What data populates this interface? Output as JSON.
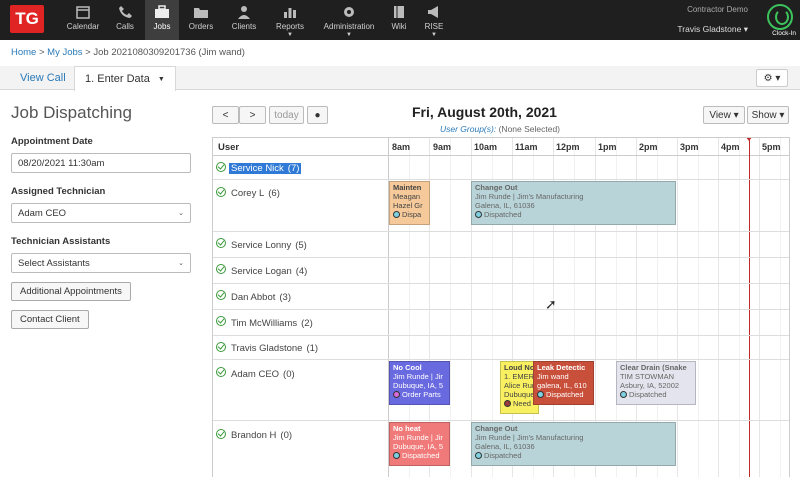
{
  "brand": {
    "logo": "TG",
    "accent": "#e02424"
  },
  "nav": {
    "items": [
      {
        "label": "Calendar",
        "icon": "calendar-icon"
      },
      {
        "label": "Calls",
        "icon": "phone-icon"
      },
      {
        "label": "Jobs",
        "icon": "briefcase-icon",
        "active": true
      },
      {
        "label": "Orders",
        "icon": "folder-icon"
      },
      {
        "label": "Clients",
        "icon": "users-icon"
      },
      {
        "label": "Reports",
        "icon": "bar-chart-icon",
        "dropdown": true
      },
      {
        "label": "Administration",
        "icon": "gear-icon",
        "dropdown": true
      },
      {
        "label": "Wiki",
        "icon": "book-icon"
      },
      {
        "label": "RISE",
        "icon": "megaphone-icon",
        "dropdown": true
      }
    ],
    "account_name": "Contractor Demo",
    "user_name": "Travis Gladstone",
    "user_caret": "▾",
    "clock_in": "Clock-In"
  },
  "breadcrumb": {
    "home": "Home",
    "sep1": " > ",
    "jobs": "My Jobs",
    "sep2": " > ",
    "current": "Job 2021080309201736 (Jim wand)"
  },
  "tabs": {
    "view_call": "View Call",
    "enter_data": "1. Enter Data",
    "caret": "▼",
    "gear_caret": "⚙ ▾"
  },
  "left": {
    "title": "Job Dispatching",
    "appointment_date_label": "Appointment Date",
    "appointment_date_value": "08/20/2021 11:30am",
    "assigned_tech_label": "Assigned Technician",
    "assigned_tech_value": "Adam CEO",
    "assistants_label": "Technician Assistants",
    "assistants_value": "Select Assistants",
    "additional_btn": "Additional Appointments",
    "contact_btn": "Contact Client",
    "chev": "⌄"
  },
  "toolbar": {
    "prev": "<",
    "next": ">",
    "today": "today",
    "globe": "●",
    "view": "View ▾",
    "show": "Show ▾"
  },
  "calendar": {
    "title": "Fri, August 20th, 2021",
    "user_groups_label": "User Group(s):",
    "user_groups_value": "(None Selected)",
    "user_col": "User",
    "hours": [
      "8am",
      "9am",
      "10am",
      "11am",
      "12pm",
      "1pm",
      "2pm",
      "3pm",
      "4pm",
      "5pm"
    ],
    "users": [
      {
        "name": "Service Nick",
        "count": "(7)"
      },
      {
        "name": "Corey L",
        "count": "(6)"
      },
      {
        "name": "Service Lonny",
        "count": "(5)"
      },
      {
        "name": "Service Logan",
        "count": "(4)"
      },
      {
        "name": "Dan Abbot",
        "count": "(3)"
      },
      {
        "name": "Tim McWilliams",
        "count": "(2)"
      },
      {
        "name": "Travis Gladstone",
        "count": "(1)"
      },
      {
        "name": "Adam CEO",
        "count": "(0)"
      },
      {
        "name": "Brandon H",
        "count": "(0)"
      }
    ],
    "events": {
      "e1": {
        "title": "Mainten",
        "l1": "Meagan",
        "l2": "Hazel Gr",
        "status": "Dispa"
      },
      "e2": {
        "title": "Change Out",
        "l1": "Jim Runde | Jim's Manufacturing",
        "l2": "Galena, IL, 61036",
        "status": "Dispatched"
      },
      "e3": {
        "title": "No Cool",
        "l1": "Jim Runde | Jir",
        "l2": "Dubuque, IA, 5",
        "status": "Order Parts"
      },
      "e4": {
        "title": "Loud Nc",
        "l1": "1. EMER",
        "l2": "Alice Rur",
        "l3": "Dubuque",
        "status": "Need"
      },
      "e5": {
        "title": "Leak Detectic",
        "l1": "Jim wand",
        "l2": "galena, IL, 610",
        "status": "Dispatched"
      },
      "e6": {
        "title": "Clear Drain (Snake",
        "l1": "TIM STOWMAN",
        "l2": "Asbury, IA, 52002",
        "status": "Dispatched"
      },
      "e7": {
        "title": "No heat",
        "l1": "Jim Runde | Jir",
        "l2": "Dubuque, IA, 5",
        "status": "Dispatched"
      },
      "e8": {
        "title": "Change Out",
        "l1": "Jim Runde | Jim's Manufacturing",
        "l2": "Galena, IL, 61036",
        "status": "Dispatched"
      }
    }
  }
}
